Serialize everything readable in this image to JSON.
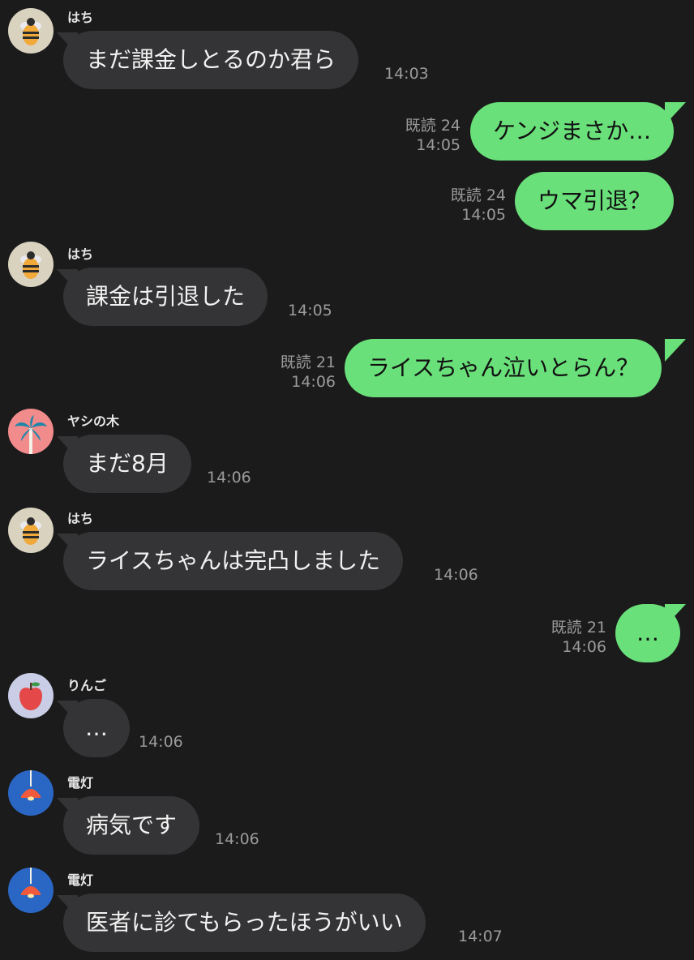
{
  "colors": {
    "background": "#1b1b1c",
    "incoming_bubble": "#343436",
    "outgoing_bubble": "#6ae07a",
    "meta_text": "#9b9b9b"
  },
  "messages": [
    {
      "sender": "はち",
      "avatar": "bee-icon",
      "text": "まだ課金しとるのか君ら",
      "time": "14:03"
    },
    {
      "read": "既読 24",
      "time": "14:05",
      "text": "ケンジまさか…"
    },
    {
      "read": "既読 24",
      "time": "14:05",
      "text": "ウマ引退？"
    },
    {
      "sender": "はち",
      "avatar": "bee-icon",
      "text": "課金は引退した",
      "time": "14:05"
    },
    {
      "read": "既読 21",
      "time": "14:06",
      "text": "ライスちゃん泣いとらん？"
    },
    {
      "sender": "ヤシの木",
      "avatar": "palm-tree-icon",
      "text": "まだ8月",
      "time": "14:06"
    },
    {
      "sender": "はち",
      "avatar": "bee-icon",
      "text": "ライスちゃんは完凸しました",
      "time": "14:06"
    },
    {
      "read": "既読 21",
      "time": "14:06",
      "text": "…"
    },
    {
      "sender": "りんご",
      "avatar": "apple-icon",
      "text": "…",
      "time": "14:06"
    },
    {
      "sender": "電灯",
      "avatar": "lamp-icon",
      "text": "病気です",
      "time": "14:06"
    },
    {
      "sender": "電灯",
      "avatar": "lamp-icon",
      "text": "医者に診てもらったほうがいい",
      "time": "14:07"
    }
  ]
}
